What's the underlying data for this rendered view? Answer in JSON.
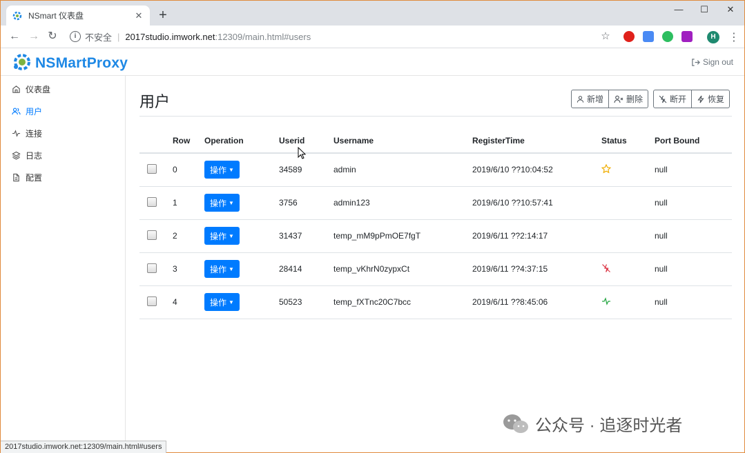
{
  "browser": {
    "tab_title": "NSmart 仪表盘",
    "close_glyph": "✕",
    "newtab_glyph": "+",
    "insecure_label": "不安全",
    "url_host": "2017studio.imwork.net",
    "url_path": ":12309/main.html#users",
    "profile_initial": "H",
    "status_url": "2017studio.imwork.net:12309/main.html#users"
  },
  "app": {
    "brand": "NSMartProxy",
    "signout_label": "Sign out",
    "sidebar": [
      {
        "label": "仪表盘",
        "icon": "home-icon"
      },
      {
        "label": "用户",
        "icon": "users-icon",
        "active": true
      },
      {
        "label": "连接",
        "icon": "activity-icon"
      },
      {
        "label": "日志",
        "icon": "layers-icon"
      },
      {
        "label": "配置",
        "icon": "file-icon"
      }
    ],
    "page_title": "用户",
    "actions": {
      "add": "新增",
      "delete": "删除",
      "disconnect": "断开",
      "restore": "恢复"
    },
    "table": {
      "headers": [
        "",
        "Row",
        "Operation",
        "Userid",
        "Username",
        "RegisterTime",
        "Status",
        "Port Bound"
      ],
      "op_label": "操作",
      "rows": [
        {
          "row": "0",
          "userid": "34589",
          "username": "admin",
          "time": "2019/6/10 ??10:04:52",
          "status": "star-icon",
          "port": "null"
        },
        {
          "row": "1",
          "userid": "3756",
          "username": "admin123",
          "time": "2019/6/10 ??10:57:41",
          "status": "",
          "port": "null"
        },
        {
          "row": "2",
          "userid": "31437",
          "username": "temp_mM9pPmOE7fgT",
          "time": "2019/6/11 ??2:14:17",
          "status": "",
          "port": "null"
        },
        {
          "row": "3",
          "userid": "28414",
          "username": "temp_vKhrN0zypxCt",
          "time": "2019/6/11 ??4:37:15",
          "status": "zap-off-icon",
          "port": "null"
        },
        {
          "row": "4",
          "userid": "50523",
          "username": "temp_fXTnc20C7bcc",
          "time": "2019/6/11 ??8:45:06",
          "status": "activity-icon",
          "port": "null"
        }
      ]
    }
  },
  "watermark": "公众号 · 追逐时光者",
  "colors": {
    "primary": "#007bff",
    "brand": "#1e88e5",
    "star": "#f0ad00",
    "danger": "#dc3545",
    "success": "#28a745"
  }
}
